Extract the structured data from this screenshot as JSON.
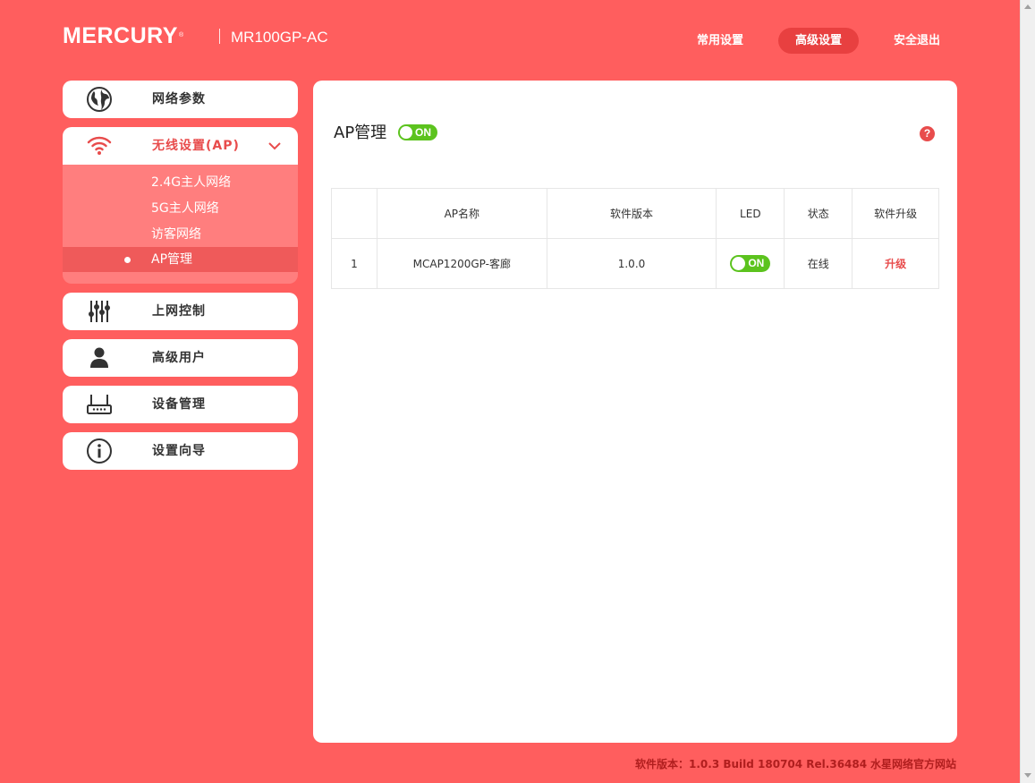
{
  "header": {
    "brand": "MERCURY",
    "trademark": "®",
    "model": "MR100GP-AC",
    "nav": {
      "common": "常用设置",
      "advanced": "高级设置",
      "logout": "安全退出"
    }
  },
  "sidebar": {
    "items": [
      {
        "label": "网络参数",
        "icon": "globe-icon"
      },
      {
        "label": "无线设置(AP)",
        "icon": "wifi-icon"
      },
      {
        "label": "上网控制",
        "icon": "sliders-icon"
      },
      {
        "label": "高级用户",
        "icon": "user-icon"
      },
      {
        "label": "设备管理",
        "icon": "router-icon"
      },
      {
        "label": "设置向导",
        "icon": "info-icon"
      }
    ],
    "submenu": [
      "2.4G主人网络",
      "5G主人网络",
      "访客网络",
      "AP管理"
    ]
  },
  "main": {
    "title": "AP管理",
    "toggle_label": "ON",
    "help": "?",
    "table": {
      "headers": [
        "",
        "AP名称",
        "软件版本",
        "LED",
        "状态",
        "软件升级"
      ],
      "rows": [
        {
          "index": "1",
          "name": "MCAP1200GP-客廊",
          "version": "1.0.0",
          "led": "ON",
          "status": "在线",
          "upgrade": "升级"
        }
      ]
    }
  },
  "footer": {
    "version": "软件版本：1.0.3 Build 180704 Rel.36484",
    "link": "水星网络官方网站"
  },
  "colors": {
    "background": "#ff5e5e",
    "accent": "#e84c4c",
    "toggle_on": "#5cc31e"
  }
}
